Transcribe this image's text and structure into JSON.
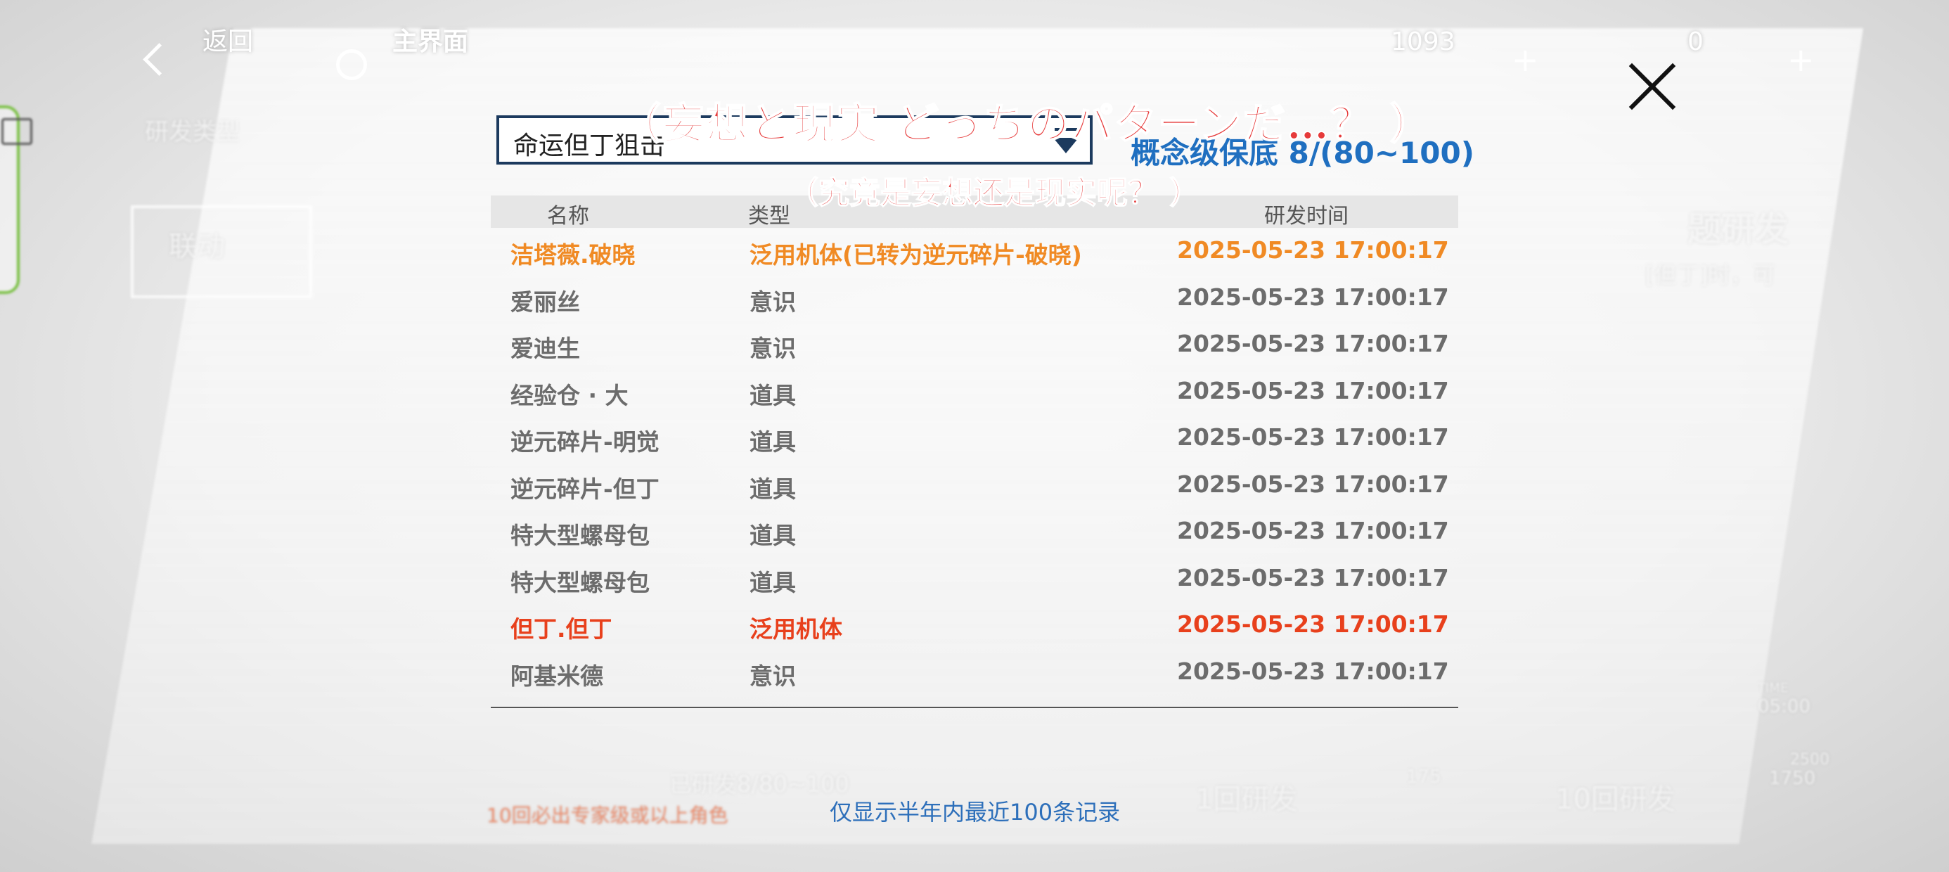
{
  "topbar": {
    "back_label": "返回",
    "home_label": "主界面",
    "currency1": "1093",
    "currency2": "0",
    "plus": "+"
  },
  "background": {
    "research_type": "研发类型",
    "collab": "联动",
    "topic_research": "题研发",
    "hint": "[但丁]时，可",
    "pity_faded": "已研发8/80~100",
    "ten_guarantee": "10回必出专家级或以上角色",
    "one_roll": "1回研发",
    "one_cost": "175",
    "ten_roll": "10回研发",
    "ten_cost": "1750",
    "ten_cost_old": "2500",
    "research_time_tag": "TIME",
    "research_time_value": "05:00"
  },
  "popup": {
    "dropdown_value": "命运但丁狙击",
    "pity_text": "概念级保底 8/(80~100)",
    "columns": [
      "名称",
      "类型",
      "研发时间"
    ],
    "rows": [
      {
        "name": "洁塔薇.破晓",
        "type": "泛用机体(已转为逆元碎片-破晓)",
        "time": "2025-05-23 17:00:17",
        "rarity": "orange"
      },
      {
        "name": "爱丽丝",
        "type": "意识",
        "time": "2025-05-23 17:00:17",
        "rarity": "normal"
      },
      {
        "name": "爱迪生",
        "type": "意识",
        "time": "2025-05-23 17:00:17",
        "rarity": "normal"
      },
      {
        "name": "经验仓 · 大",
        "type": "道具",
        "time": "2025-05-23 17:00:17",
        "rarity": "normal"
      },
      {
        "name": "逆元碎片-明觉",
        "type": "道具",
        "time": "2025-05-23 17:00:17",
        "rarity": "normal"
      },
      {
        "name": "逆元碎片-但丁",
        "type": "道具",
        "time": "2025-05-23 17:00:17",
        "rarity": "normal"
      },
      {
        "name": "特大型螺母包",
        "type": "道具",
        "time": "2025-05-23 17:00:17",
        "rarity": "normal"
      },
      {
        "name": "特大型螺母包",
        "type": "道具",
        "time": "2025-05-23 17:00:17",
        "rarity": "normal"
      },
      {
        "name": "但丁.但丁",
        "type": "泛用机体",
        "time": "2025-05-23 17:00:17",
        "rarity": "red"
      },
      {
        "name": "阿基米德",
        "type": "意识",
        "time": "2025-05-23 17:00:17",
        "rarity": "normal"
      }
    ],
    "footer_note": "仅显示半年内最近100条记录"
  },
  "captions": {
    "line1": "（妄想と現実 どっちのパターンだ…？ ）",
    "line2": "（究竟是妄想还是现实呢？ ）"
  },
  "colors": {
    "orange": "#f08a24",
    "red": "#e8401c",
    "blue": "#1f6fc0",
    "normal": "#6c6c6c"
  }
}
